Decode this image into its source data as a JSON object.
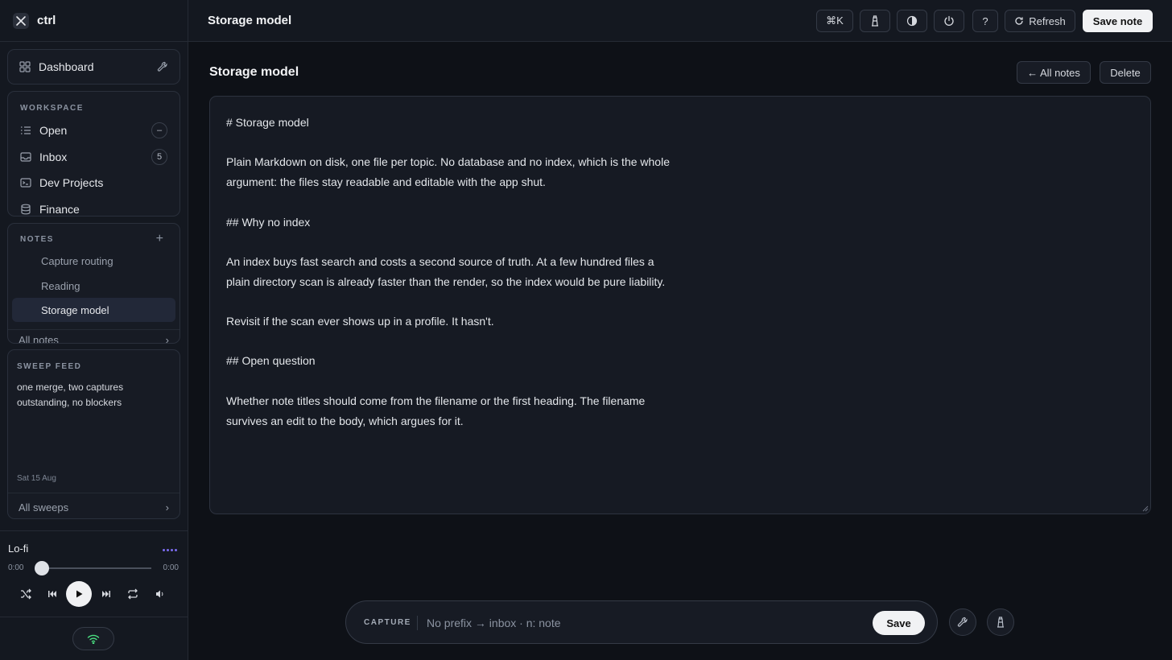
{
  "app": {
    "name": "ctrl"
  },
  "sidebar": {
    "dashboard_label": "Dashboard",
    "workspace": {
      "title": "WORKSPACE",
      "items": [
        {
          "label": "Open",
          "badge": "–"
        },
        {
          "label": "Inbox",
          "badge": "5"
        },
        {
          "label": "Dev Projects"
        },
        {
          "label": "Finance"
        }
      ]
    },
    "notes": {
      "title": "NOTES",
      "add_label": "+",
      "items": [
        "Capture routing",
        "Reading",
        "Storage model"
      ],
      "active": "Storage model",
      "all_label": "All notes"
    },
    "sweep": {
      "title": "SWEEP FEED",
      "text": "one merge, two captures outstanding, no blockers",
      "date": "Sat 15 Aug",
      "all_label": "All sweeps"
    },
    "player": {
      "title": "Lo-fi",
      "elapsed": "0:00",
      "duration": "0:00",
      "progress": 0
    }
  },
  "topbar": {
    "title": "Storage model",
    "cmdk_label": "⌘K",
    "help_label": "?",
    "refresh_label": "Refresh",
    "save_label": "Save note"
  },
  "main": {
    "title": "Storage model",
    "all_notes_label": "← All notes",
    "delete_label": "Delete",
    "body": "# Storage model\n\nPlain Markdown on disk, one file per topic. No database and no index, which is the whole argument: the files stay readable and editable with the app shut.\n\n## Why no index\n\nAn index buys fast search and costs a second source of truth. At a few hundred files a plain directory scan is already faster than the render, so the index would be pure liability.\n\nRevisit if the scan ever shows up in a profile. It hasn't.\n\n## Open question\n\nWhether note titles should come from the filename or the first heading. The filename survives an edit to the body, which argues for it."
  },
  "capture": {
    "label": "CAPTURE",
    "placeholder": "No prefix → inbox · n: note",
    "value": "",
    "save_label": "Save"
  },
  "colors": {
    "background": "#0e1117",
    "panel": "#171b24",
    "accent": "#7c6cf0",
    "wifi": "#4ade80"
  }
}
